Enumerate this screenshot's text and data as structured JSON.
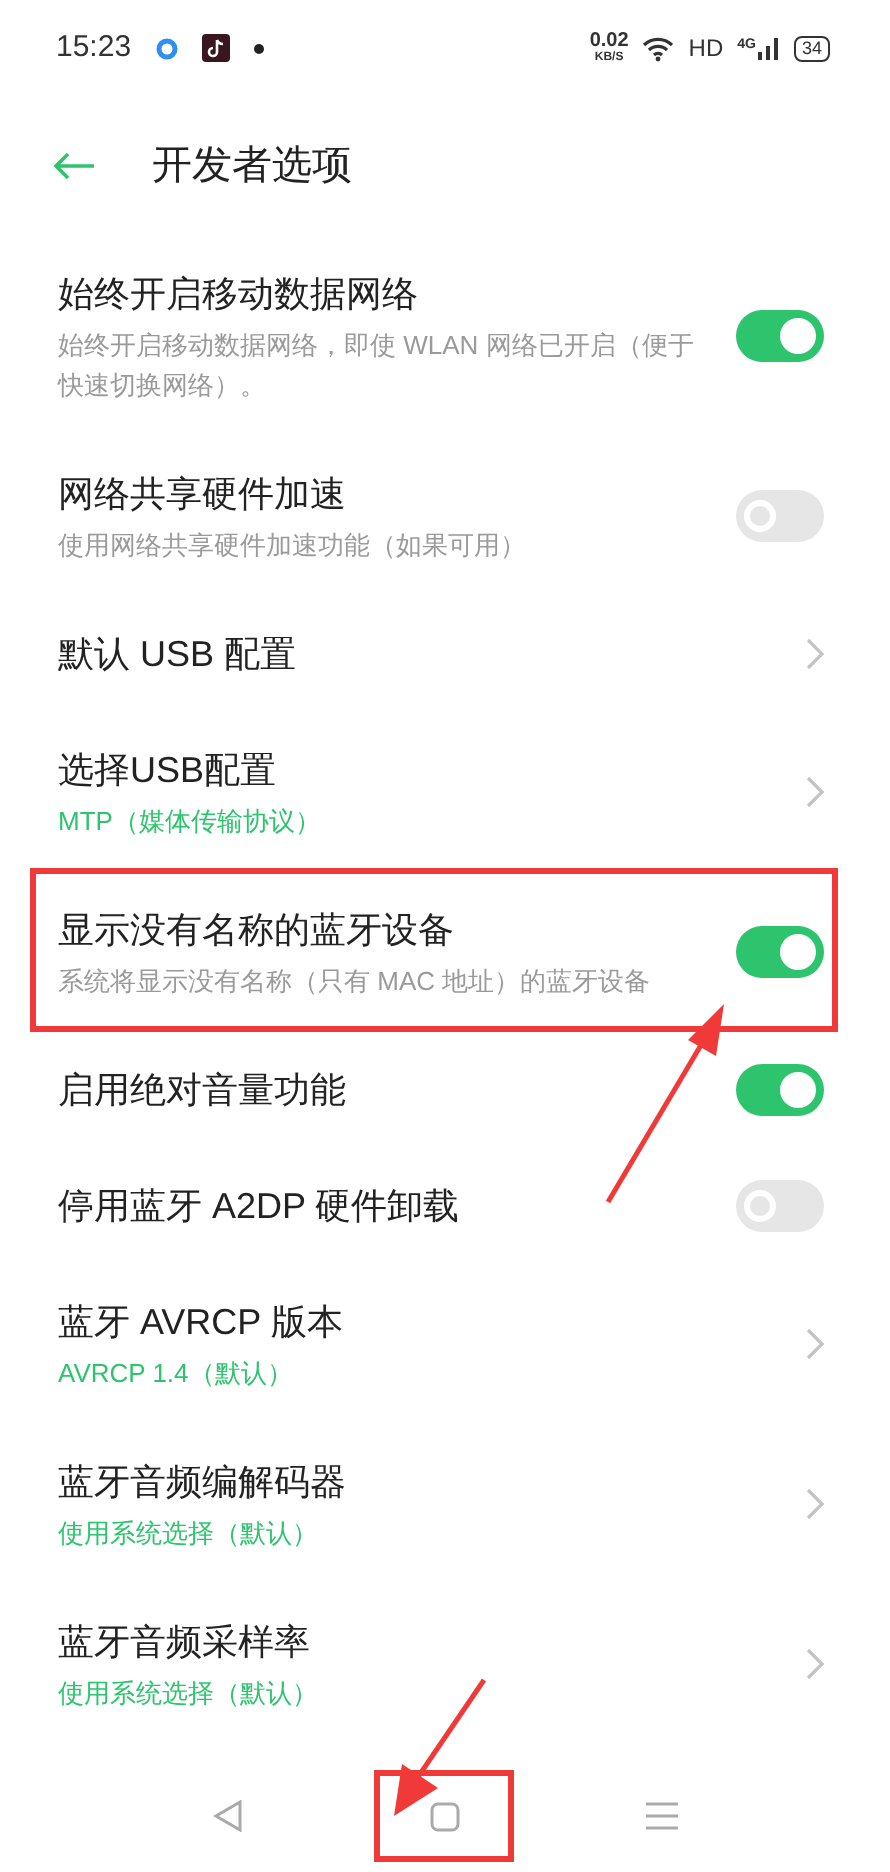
{
  "status_bar": {
    "time": "15:23",
    "speed": "0.02",
    "speed_unit": "KB/S",
    "hd": "HD",
    "network": "4G",
    "battery": "34"
  },
  "header": {
    "title": "开发者选项"
  },
  "items": [
    {
      "kind": "toggle",
      "title": "始终开启移动数据网络",
      "subtitle": "始终开启移动数据网络，即使 WLAN 网络已开启（便于快速切换网络）。",
      "on": true,
      "highlighted": false
    },
    {
      "kind": "toggle",
      "title": "网络共享硬件加速",
      "subtitle": "使用网络共享硬件加速功能（如果可用）",
      "on": false,
      "highlighted": false
    },
    {
      "kind": "link",
      "title": "默认 USB 配置",
      "highlighted": false
    },
    {
      "kind": "link",
      "title": "选择USB配置",
      "value": "MTP（媒体传输协议）",
      "highlighted": false
    },
    {
      "kind": "toggle",
      "title": "显示没有名称的蓝牙设备",
      "subtitle": "系统将显示没有名称（只有 MAC 地址）的蓝牙设备",
      "on": true,
      "highlighted": true
    },
    {
      "kind": "toggle",
      "title": "启用绝对音量功能",
      "on": true,
      "highlighted": false
    },
    {
      "kind": "toggle",
      "title": "停用蓝牙 A2DP 硬件卸载",
      "on": false,
      "highlighted": false
    },
    {
      "kind": "link",
      "title": "蓝牙 AVRCP 版本",
      "value": "AVRCP 1.4（默认）",
      "highlighted": false
    },
    {
      "kind": "link",
      "title": "蓝牙音频编解码器",
      "value": "使用系统选择（默认）",
      "highlighted": false
    },
    {
      "kind": "link",
      "title": "蓝牙音频采样率",
      "value": "使用系统选择（默认）",
      "highlighted": false
    }
  ],
  "nav_bar": {
    "home_highlighted": true
  }
}
